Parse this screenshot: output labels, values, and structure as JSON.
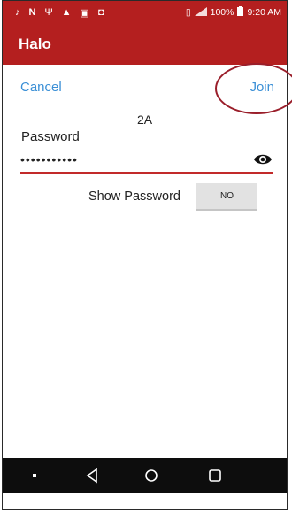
{
  "status_bar": {
    "left_icons": [
      "tiktok-icon",
      "n-icon",
      "usb-icon",
      "alert-icon",
      "image-icon",
      "notification-icon"
    ],
    "battery": "100%",
    "time": "9:20 AM"
  },
  "app_bar": {
    "title": "Halo"
  },
  "actions": {
    "cancel_label": "Cancel",
    "join_label": "Join"
  },
  "network": {
    "name": "2A"
  },
  "password": {
    "label": "Password",
    "value": "•••••••••••"
  },
  "show_password": {
    "label": "Show Password",
    "toggle_label": "NO"
  },
  "colors": {
    "accent": "#b41f1f",
    "link": "#3a8fd6",
    "annotation": "#9a1e2a"
  },
  "nav_bar": {
    "icons": [
      "menu-dot-icon",
      "back-icon",
      "home-icon",
      "recents-icon"
    ]
  }
}
